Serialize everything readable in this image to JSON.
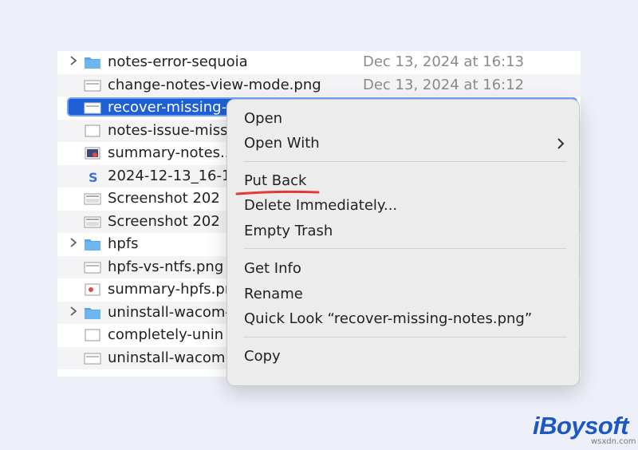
{
  "files": [
    {
      "name": "notes-error-sequoia",
      "date": "Dec 13, 2024 at 16:13",
      "type": "folder",
      "chevron": true
    },
    {
      "name": "change-notes-view-mode.png",
      "date": "Dec 13, 2024 at 16:12",
      "type": "image"
    },
    {
      "name": "recover-missing-",
      "date": "",
      "type": "image",
      "selected": true
    },
    {
      "name": "notes-issue-miss",
      "date": "",
      "type": "blank"
    },
    {
      "name": "summary-notes...",
      "date": "",
      "type": "photo"
    },
    {
      "name": "2024-12-13_16-1",
      "date": "",
      "type": "swift"
    },
    {
      "name": "Screenshot 202",
      "date": "",
      "type": "screenshot"
    },
    {
      "name": "Screenshot 202",
      "date": "",
      "type": "screenshot"
    },
    {
      "name": "hpfs",
      "date": "",
      "type": "folder",
      "chevron": true
    },
    {
      "name": "hpfs-vs-ntfs.png",
      "date": "",
      "type": "image"
    },
    {
      "name": "summary-hpfs.pn",
      "date": "",
      "type": "photo"
    },
    {
      "name": "uninstall-wacom-",
      "date": "",
      "type": "folder",
      "chevron": true
    },
    {
      "name": "completely-unin",
      "date": "",
      "type": "blank"
    },
    {
      "name": "uninstall-wacom",
      "date": "",
      "type": "image"
    }
  ],
  "context_menu": {
    "open": "Open",
    "open_with": "Open With",
    "put_back": "Put Back",
    "delete_immediately": "Delete Immediately...",
    "empty_trash": "Empty Trash",
    "get_info": "Get Info",
    "rename": "Rename",
    "quick_look": "Quick Look “recover-missing-notes.png”",
    "copy": "Copy"
  },
  "branding": {
    "logo": "iBoysoft",
    "watermark": "wsxdn.com"
  },
  "colors": {
    "selection": "#1f5fd6",
    "folder": "#5aa9e6",
    "highlight_underline": "#e53935",
    "logo": "#1c57c5"
  }
}
